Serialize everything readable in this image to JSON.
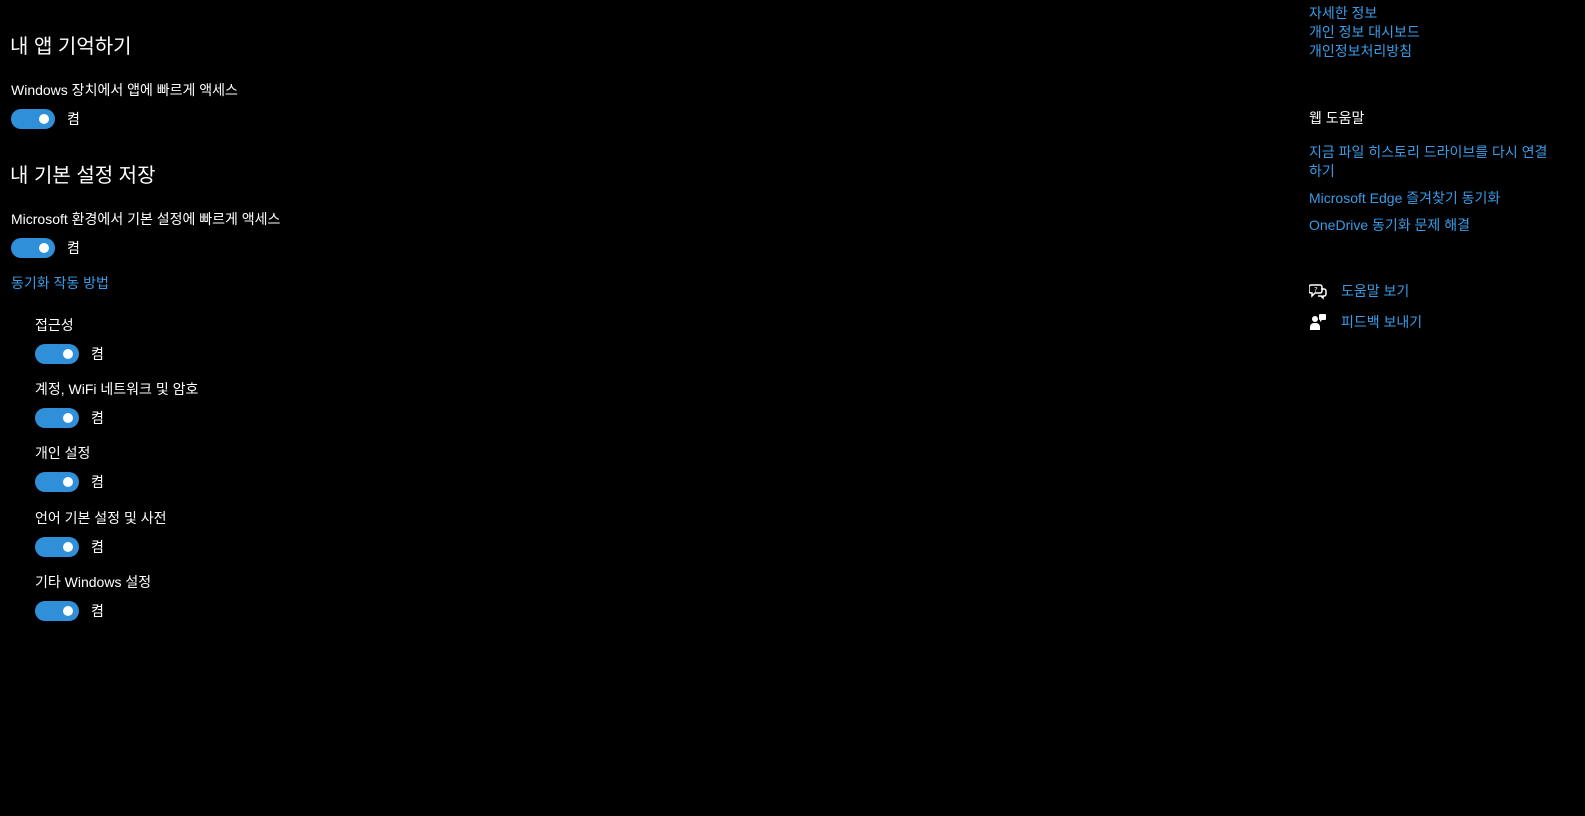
{
  "main": {
    "remember_apps": {
      "heading": "내 앱 기억하기",
      "setting_label": "Windows 장치에서 앱에 빠르게 액세스",
      "state": "켬"
    },
    "save_prefs": {
      "heading": "내 기본 설정 저장",
      "setting_label": "Microsoft 환경에서 기본 설정에 빠르게 액세스",
      "state": "켬",
      "how_sync_link": "동기화 작동 방법"
    },
    "sync_items": [
      {
        "label": "접근성",
        "state": "켬"
      },
      {
        "label": "계정, WiFi 네트워크 및 암호",
        "state": "켬"
      },
      {
        "label": "개인 설정",
        "state": "켬"
      },
      {
        "label": "언어 기본 설정 및 사전",
        "state": "켬"
      },
      {
        "label": "기타 Windows 설정",
        "state": "켬"
      }
    ]
  },
  "side": {
    "top_links": [
      "자세한 정보",
      "개인 정보 대시보드",
      "개인정보처리방침"
    ],
    "web_help": {
      "heading": "웹 도움말",
      "links": [
        "지금 파일 히스토리 드라이브를 다시 연결하기",
        "Microsoft Edge 즐겨찾기 동기화",
        "OneDrive 동기화 문제 해결"
      ]
    },
    "help": {
      "get_help": "도움말 보기",
      "send_feedback": "피드백 보내기"
    }
  },
  "colors": {
    "background": "#000000",
    "accent": "#2f8fd8",
    "link": "#3a9be6",
    "text": "#ffffff"
  },
  "icons": {
    "get_help": "help-chat-icon",
    "send_feedback": "feedback-person-icon"
  }
}
